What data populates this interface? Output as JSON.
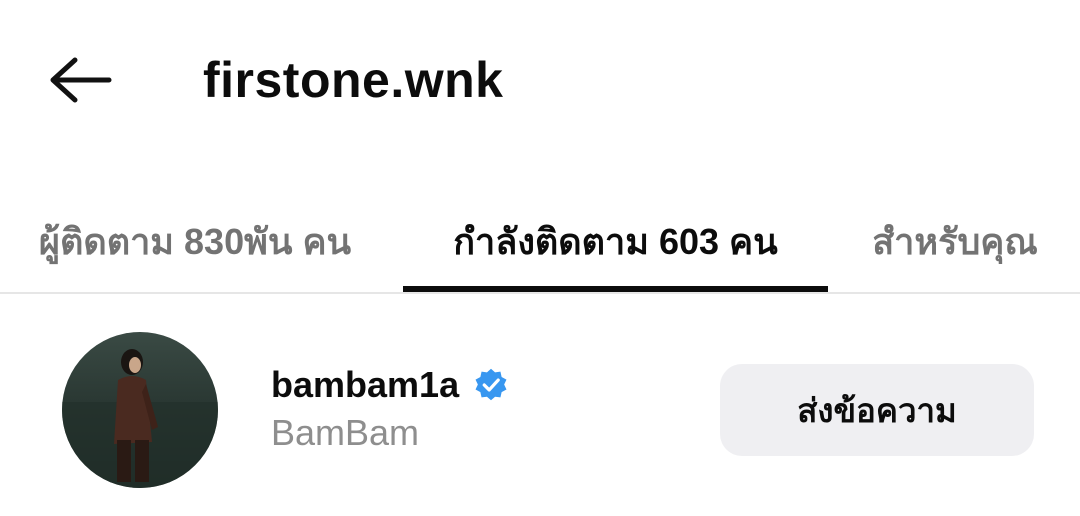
{
  "header": {
    "back_icon": "arrow-left-icon",
    "title": "firstone.wnk"
  },
  "tabs": [
    {
      "label": "ผู้ติดตาม 830พัน คน",
      "active": false
    },
    {
      "label": "กำลังติดตาม 603 คน",
      "active": true
    },
    {
      "label": "สำหรับคุณ",
      "active": false
    }
  ],
  "following_list": [
    {
      "username": "bambam1a",
      "display_name": "BamBam",
      "verified": true,
      "verified_icon": "verified-badge-icon",
      "action_label": "ส่งข้อความ"
    }
  ],
  "colors": {
    "text_primary": "#0c0c0c",
    "text_secondary": "#737373",
    "verified_blue": "#3897f0",
    "button_bg": "#efeff2"
  }
}
